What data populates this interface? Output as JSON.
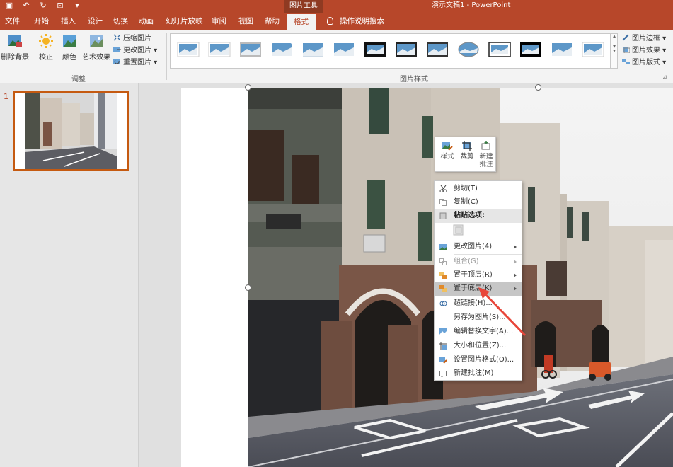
{
  "titlebar": {
    "context_tool": "图片工具",
    "doc_title": "演示文稿1  -  PowerPoint"
  },
  "tabs": [
    "文件",
    "开始",
    "插入",
    "设计",
    "切换",
    "动画",
    "幻灯片放映",
    "审阅",
    "视图",
    "帮助",
    "格式"
  ],
  "search_label": "操作说明搜索",
  "ribbon": {
    "remove_bg": "删除背景",
    "corrections": "校正",
    "color": "颜色",
    "artistic": "艺术效果",
    "compress": "压缩图片",
    "change_pic": "更改图片",
    "reset_pic": "重置图片",
    "adjust_group": "调整",
    "styles_group": "图片样式",
    "border": "图片边框",
    "effects": "图片效果",
    "layout": "图片版式"
  },
  "thumbnails": {
    "slide_number": "1"
  },
  "minibar": {
    "style": "样式",
    "crop": "裁剪",
    "new_comment_1": "新建",
    "new_comment_2": "批注"
  },
  "context_menu": {
    "cut": "剪切(T)",
    "copy": "复制(C)",
    "paste_options": "粘贴选项:",
    "change_picture": "更改图片(4)",
    "group": "组合(G)",
    "bring_front": "置于顶层(R)",
    "send_back": "置于底层(K)",
    "hyperlink": "超链接(H)...",
    "save_as_picture": "另存为图片(S)...",
    "alt_text": "编辑替换文字(A)...",
    "size_position": "大小和位置(Z)...",
    "format_picture": "设置图片格式(O)...",
    "new_comment": "新建批注(M)"
  },
  "colors": {
    "accent": "#b7472a",
    "highlight": "#c55a11",
    "arrow": "#e8463a"
  }
}
